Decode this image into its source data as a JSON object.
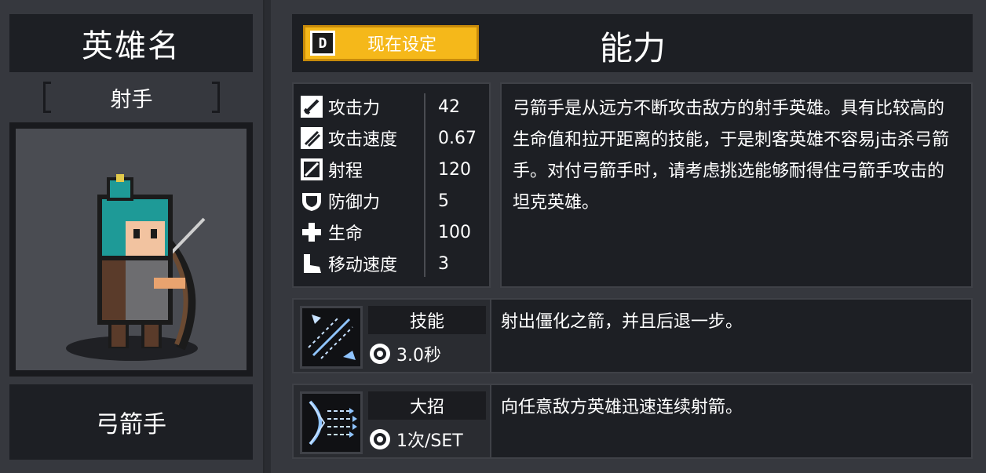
{
  "hero": {
    "name_title": "英雄名",
    "role": "射手",
    "class_name": "弓箭手"
  },
  "header": {
    "set_button_label": "现在设定",
    "set_button_key": "D",
    "ability_title": "能力"
  },
  "stats": [
    {
      "icon": "sword-icon",
      "label": "攻击力",
      "value": "42"
    },
    {
      "icon": "attack-speed-icon",
      "label": "攻击速度",
      "value": "0.67"
    },
    {
      "icon": "range-icon",
      "label": "射程",
      "value": "120"
    },
    {
      "icon": "shield-icon",
      "label": "防御力",
      "value": "5"
    },
    {
      "icon": "health-cross-icon",
      "label": "生命",
      "value": "100"
    },
    {
      "icon": "boot-icon",
      "label": "移动速度",
      "value": "3"
    }
  ],
  "description": "弓箭手是从远方不断攻击敌方的射手英雄。具有比较高的生命值和拉开距离的技能，于是刺客英雄不容易j击杀弓箭手。对付弓箭手时，请考虑挑选能够耐得住弓箭手攻击的坦克英雄。",
  "skill": {
    "name": "技能",
    "cooldown": "3.0秒",
    "description": "射出僵化之箭，并且后退一步。",
    "icon": "frost-arrow-icon"
  },
  "ultimate": {
    "name": "大招",
    "cooldown": "1次/SET",
    "description": "向任意敌方英雄迅速连续射箭。",
    "icon": "arrow-volley-icon"
  },
  "colors": {
    "accent_yellow": "#f5b81a",
    "panel_dark": "#1d1f24",
    "frame": "#36383e",
    "skill_ice": "#8fc4ff"
  }
}
